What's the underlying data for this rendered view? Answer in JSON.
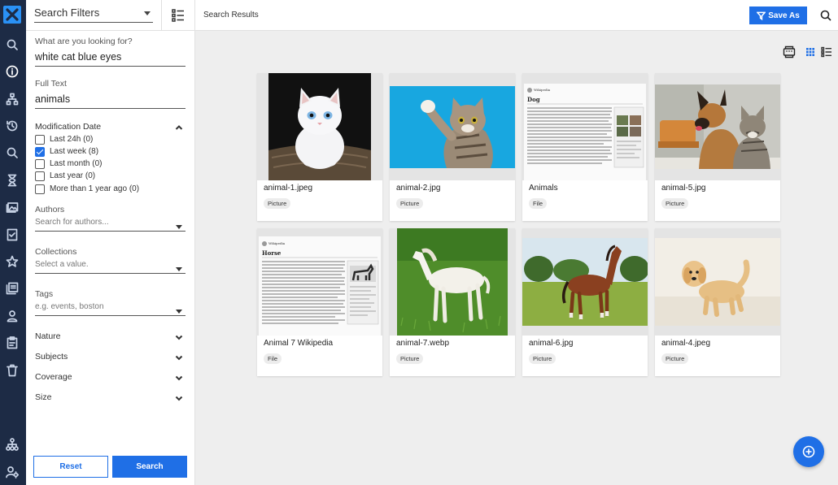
{
  "app": {
    "accent_color": "#1f6fe6",
    "rail_color": "#1d2b45"
  },
  "rail": {
    "icons": [
      "logo-icon",
      "search-icon",
      "info-icon",
      "hierarchy-icon",
      "history-icon",
      "search-icon",
      "hourglass-icon",
      "gallery-icon",
      "checklist-icon",
      "star-icon",
      "collections-icon",
      "user-icon",
      "clipboard-icon",
      "trash-icon",
      "sitemap-icon",
      "user-settings-icon"
    ]
  },
  "filters": {
    "selector_label": "Search Filters",
    "looking_for": {
      "label": "What are you looking for?",
      "value": "white cat blue eyes"
    },
    "full_text": {
      "label": "Full Text",
      "value": "animals"
    },
    "modification_date": {
      "title": "Modification Date",
      "options": [
        {
          "label": "Last 24h (0)",
          "checked": false
        },
        {
          "label": "Last week (8)",
          "checked": true
        },
        {
          "label": "Last month (0)",
          "checked": false
        },
        {
          "label": "Last year (0)",
          "checked": false
        },
        {
          "label": "More than 1 year ago (0)",
          "checked": false
        }
      ]
    },
    "authors": {
      "label": "Authors",
      "placeholder": "Search for authors..."
    },
    "collections": {
      "label": "Collections",
      "placeholder": "Select a value."
    },
    "tags": {
      "label": "Tags",
      "placeholder": "e.g. events, boston"
    },
    "sections": [
      "Nature",
      "Subjects",
      "Coverage",
      "Size"
    ],
    "reset_label": "Reset",
    "search_label": "Search"
  },
  "topbar": {
    "title": "Search Results",
    "save_as_label": "Save As"
  },
  "results": [
    {
      "name": "animal-1.jpeg",
      "type": "Picture",
      "subject": "white-kitten"
    },
    {
      "name": "animal-2.jpg",
      "type": "Picture",
      "subject": "tabby-cat-blue-bg"
    },
    {
      "name": "Animals",
      "type": "File",
      "subject": "wikipedia-dog-page"
    },
    {
      "name": "animal-5.jpg",
      "type": "Picture",
      "subject": "dog-and-cat"
    },
    {
      "name": "Animal 7 Wikipedia",
      "type": "File",
      "subject": "wikipedia-horse-page"
    },
    {
      "name": "animal-7.webp",
      "type": "Picture",
      "subject": "white-foal"
    },
    {
      "name": "animal-6.jpg",
      "type": "Picture",
      "subject": "brown-horse"
    },
    {
      "name": "animal-4.jpeg",
      "type": "Picture",
      "subject": "golden-puppy"
    }
  ],
  "doc_thumbs": {
    "dog": {
      "site": "Wikipedia",
      "heading": "Dog"
    },
    "horse": {
      "site": "Wikipedia",
      "heading": "Horse"
    }
  }
}
